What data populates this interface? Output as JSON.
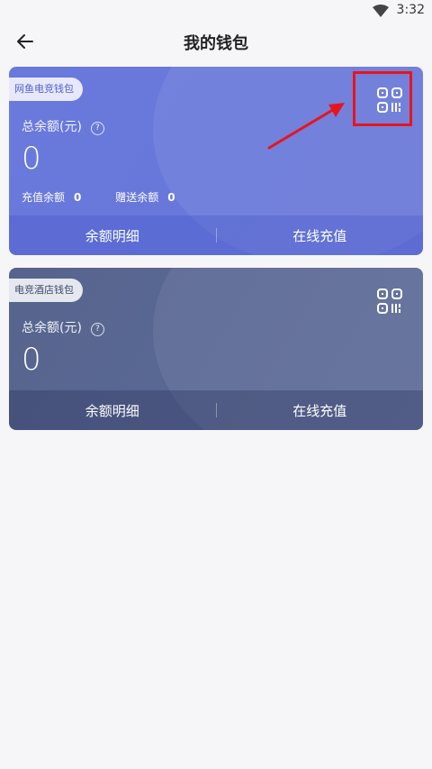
{
  "status": {
    "time": "3:32"
  },
  "header": {
    "title": "我的钱包"
  },
  "cards": [
    {
      "tag": "网鱼电竞钱包",
      "total_label": "总余额(元)",
      "amount": "0",
      "recharge_label": "充值余额",
      "recharge_value": "0",
      "gift_label": "赠送余额",
      "gift_value": "0",
      "detail_label": "余额明细",
      "topup_label": "在线充值"
    },
    {
      "tag": "电竞酒店钱包",
      "total_label": "总余额(元)",
      "amount": "0",
      "detail_label": "余额明细",
      "topup_label": "在线充值"
    }
  ],
  "icons": {
    "qr": "qr-code-icon",
    "back": "back-arrow-icon",
    "help": "help-icon",
    "wifi": "wifi-icon"
  },
  "colors": {
    "card1": "#6a79dc",
    "card2": "#56648d",
    "highlight": "#e8141d"
  }
}
